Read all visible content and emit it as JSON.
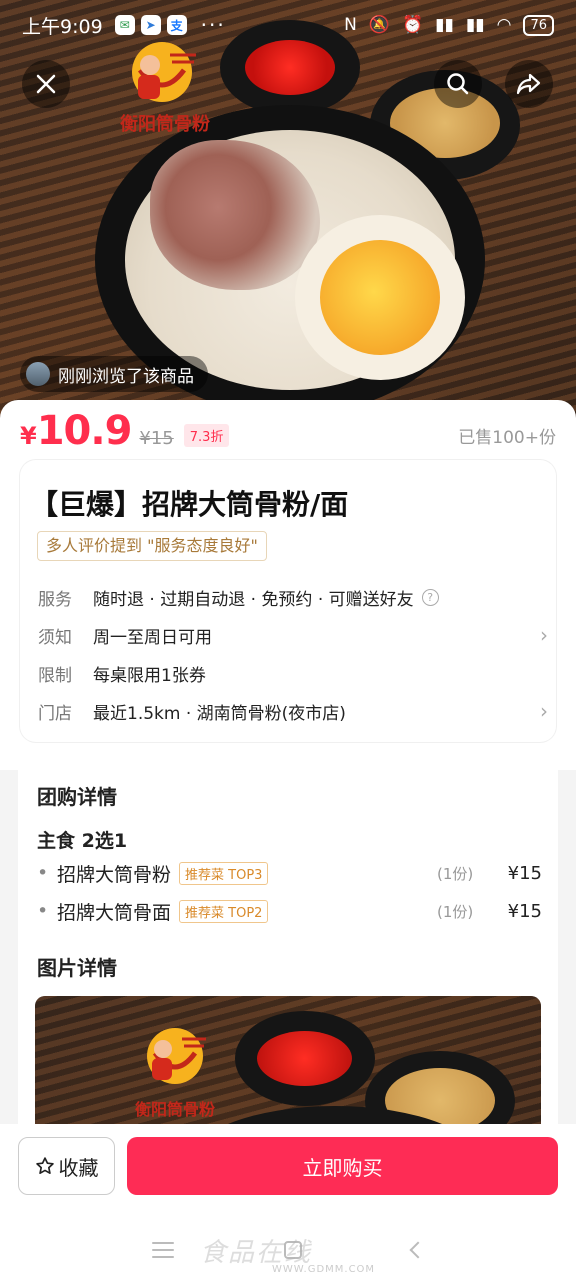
{
  "status_bar": {
    "time": "上午9:09",
    "app_icons": [
      "wechat-icon",
      "location-icon",
      "alipay-icon"
    ],
    "alipay_label": "支",
    "more": "···",
    "battery": "76"
  },
  "hero": {
    "viewed_text": "刚刚浏览了该商品",
    "logo_text": "衡阳筒骨粉"
  },
  "price": {
    "currency": "¥",
    "current": "10.9",
    "original": "¥15",
    "discount": "7.3折",
    "sold": "已售100+份"
  },
  "product": {
    "title": "【巨爆】招牌大筒骨粉/面",
    "review_tag": "多人评价提到 \"服务态度良好\""
  },
  "info_rows": [
    {
      "key": "服务",
      "value": "随时退 · 过期自动退 · 免预约 · 可赠送好友"
    },
    {
      "key": "须知",
      "value": "周一至周日可用"
    },
    {
      "key": "限制",
      "value": "每桌限用1张券"
    },
    {
      "key": "门店",
      "value": "最近1.5km · 湖南筒骨粉(夜市店)"
    }
  ],
  "details": {
    "section_title": "团购详情",
    "group_title": "主食 2选1",
    "items": [
      {
        "name": "招牌大筒骨粉",
        "tag": "推荐菜 TOP3",
        "qty": "(1份)",
        "price": "¥15"
      },
      {
        "name": "招牌大筒骨面",
        "tag": "推荐菜 TOP2",
        "qty": "(1份)",
        "price": "¥15"
      }
    ],
    "photo_title": "图片详情",
    "photo_logo_text": "衡阳筒骨粉"
  },
  "actions": {
    "favorite": "收藏",
    "buy": "立即购买"
  },
  "watermark": {
    "main": "食品在线",
    "sub": "WWW.GDMM.COM"
  },
  "colors": {
    "accent": "#fe2c55",
    "price": "#ff2e4d",
    "tag": "#d98a2a"
  }
}
